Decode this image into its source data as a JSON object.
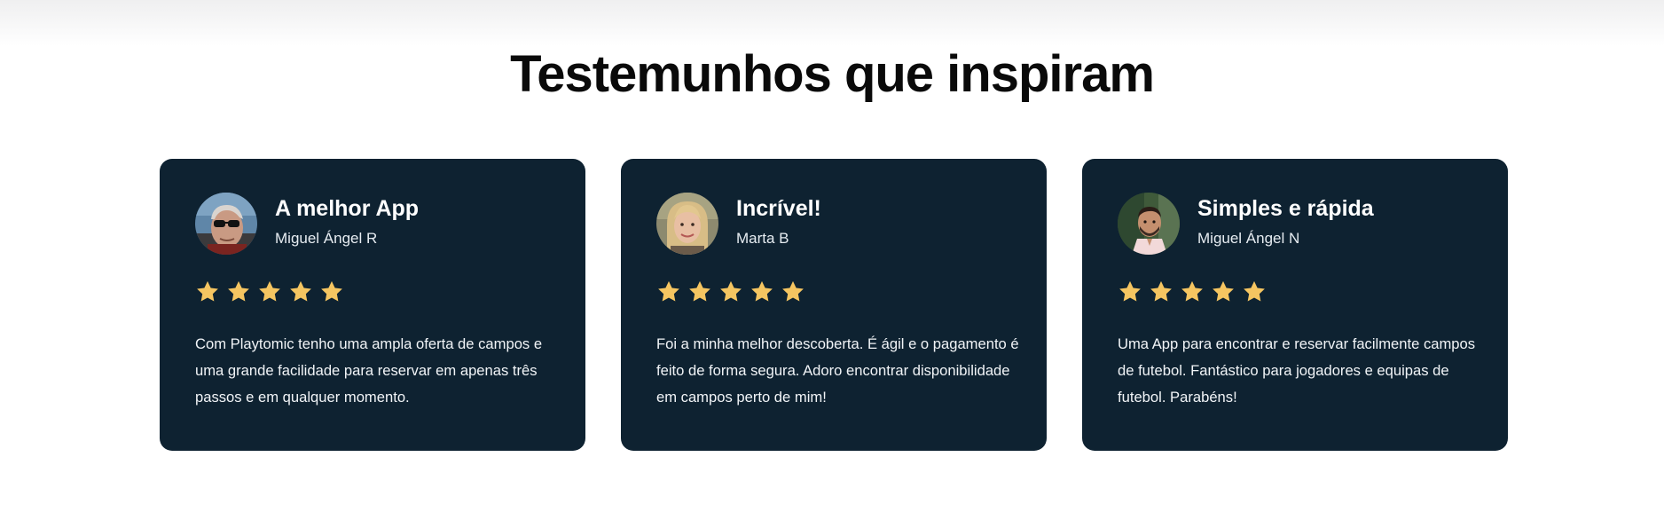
{
  "section": {
    "title": "Testemunhos que inspiram"
  },
  "colors": {
    "card_bg": "#0e2231",
    "star": "#f5c561",
    "title": "#0a0a0a"
  },
  "testimonials": [
    {
      "title": "A melhor App",
      "author": "Miguel Ángel R",
      "rating": 5,
      "quote": "Com Playtomic tenho uma ampla oferta de campos e uma grande facilidade para reservar em apenas três passos e em qualquer momento.",
      "avatar_icon": "avatar-photo-older-man-sunglasses"
    },
    {
      "title": "Incrível!",
      "author": "Marta B",
      "rating": 5,
      "quote": "Foi a minha melhor descoberta. É ágil e o pagamento é feito de forma segura. Adoro encontrar disponibilidade em campos perto de mim!",
      "avatar_icon": "avatar-photo-blonde-woman"
    },
    {
      "title": "Simples e rápida",
      "author": "Miguel Ángel N",
      "rating": 5,
      "quote": "Uma App para encontrar e reservar facilmente campos de futebol. Fantástico para jogadores e equipas de futebol. Parabéns!",
      "avatar_icon": "avatar-photo-young-man-beard"
    }
  ]
}
